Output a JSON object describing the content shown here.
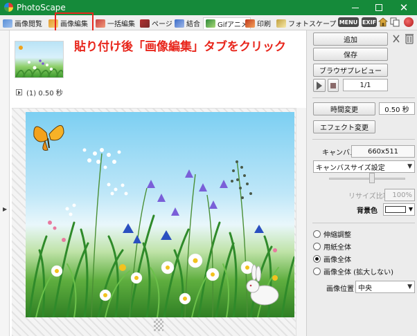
{
  "window": {
    "title": "PhotoScape",
    "minimize_label": "",
    "maximize_label": "",
    "close_label": "✕"
  },
  "tabs": [
    {
      "label": "画像閲覧",
      "icon": "viewer-icon"
    },
    {
      "label": "画像編集",
      "icon": "image-edit-icon"
    },
    {
      "label": "一括編集",
      "icon": "batch-edit-icon"
    },
    {
      "label": "ページ",
      "icon": "page-icon"
    },
    {
      "label": "結合",
      "icon": "combine-icon"
    },
    {
      "label": "Gifアニメ",
      "icon": "gif-animation-icon",
      "active": true
    },
    {
      "label": "印刷",
      "icon": "print-icon"
    },
    {
      "label": "フォトスケープ",
      "icon": "photoscape-icon"
    }
  ],
  "toolbar_right": {
    "menu_label": "MENU",
    "exif_label": "EXIF"
  },
  "annotation": {
    "text": "貼り付け後「画像編集」タブをクリック",
    "color": "#e8261c"
  },
  "frames": {
    "items": [
      {
        "caption": "(1) 0.50 秒"
      }
    ]
  },
  "right_panel": {
    "add_label": "追加",
    "save_label": "保存",
    "browser_preview_label": "ブラウザプレビュー",
    "frame_counter": "1/1",
    "change_time_label": "時間変更",
    "time_value": "0.50 秒",
    "change_effect_label": "エフェクト変更",
    "canvas_label": "キャンバス",
    "canvas_size": "660x511",
    "canvas_size_setting": "キャンバスサイズ設定",
    "resize_ratio_label": "リサイズ比率",
    "resize_ratio_value": "100%",
    "bg_color_label": "背景色",
    "bg_color": "#ffffff",
    "fit_options": [
      {
        "label": "伸縮調整",
        "selected": false
      },
      {
        "label": "用紙全体",
        "selected": false
      },
      {
        "label": "画像全体",
        "selected": true
      },
      {
        "label": "画像全体 (拡大しない)",
        "selected": false
      }
    ],
    "image_position_label": "画像位置",
    "image_position_value": "中央"
  },
  "colors": {
    "titlebar": "#158a3a",
    "panel_bg": "#ececec",
    "highlight": "#e8261c"
  }
}
